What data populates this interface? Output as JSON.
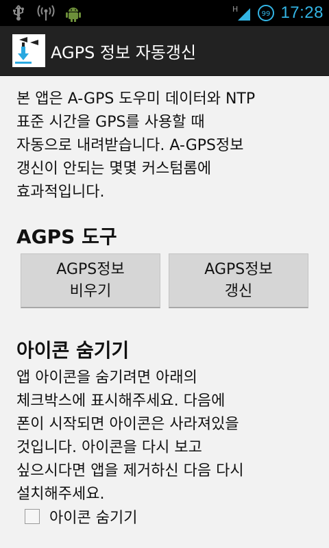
{
  "status_bar": {
    "icons_left": [
      "usb-icon",
      "wifi-hotspot-icon",
      "android-debug-icon"
    ],
    "signal_label": "H",
    "battery_level": "99",
    "time": "17:28",
    "accent_color": "#33b5e5"
  },
  "action_bar": {
    "title": "AGPS 정보 자동갱신"
  },
  "intro": {
    "lines": [
      "본 앱은 A-GPS 도우미 데이터와 NTP",
      "표준 시간을 GPS를 사용할 때",
      "자동으로 내려받습니다. A-GPS정보",
      "갱신이 안되는 몇몇 커스텀롬에",
      "효과적입니다."
    ]
  },
  "tools": {
    "title": "AGPS 도구",
    "clear_button": "AGPS정보\n비우기",
    "update_button": "AGPS정보\n갱신"
  },
  "hide_icon": {
    "title": "아이콘 숨기기",
    "lines": [
      "앱 아이콘을 숨기려면 아래의",
      "체크박스에 표시해주세요. 다음에",
      "폰이 시작되면 아이콘은 사라져있을",
      "것입니다. 아이콘을 다시 보고",
      "싶으시다면 앱을 제거하신 다음 다시",
      "설치해주세요."
    ],
    "checkbox_label": "아이콘 숨기기",
    "checkbox_checked": false
  }
}
